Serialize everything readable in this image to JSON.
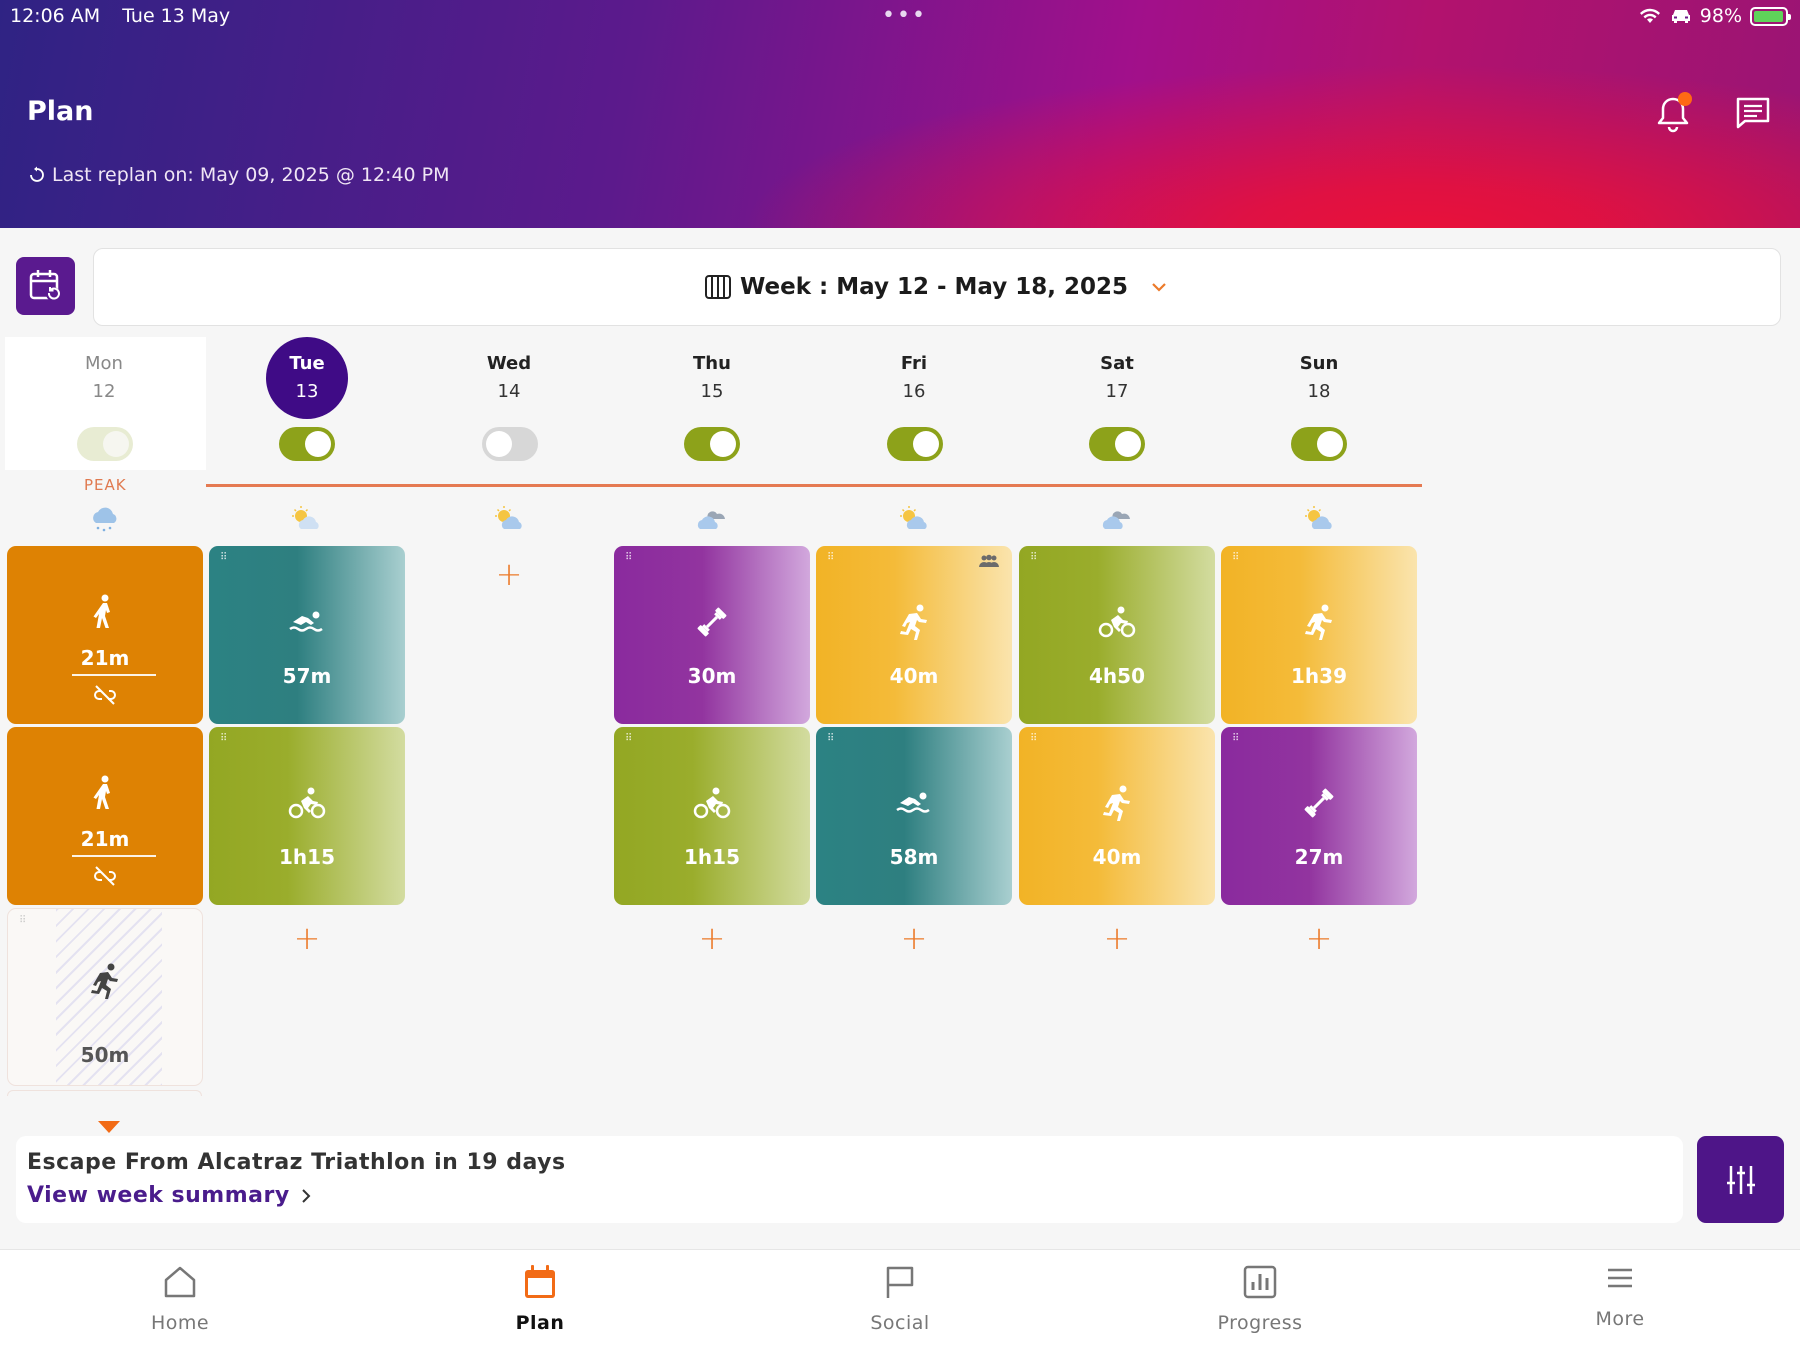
{
  "status_bar": {
    "time": "12:06 AM",
    "date": "Tue 13 May",
    "battery": "98%",
    "battery_level": 0.98
  },
  "header": {
    "title": "Plan",
    "replan": "Last replan on: May 09, 2025 @ 12:40 PM"
  },
  "week_selector": {
    "label": "Week : May 12 - May 18, 2025"
  },
  "days": [
    {
      "name": "Mon",
      "num": "12"
    },
    {
      "name": "Tue",
      "num": "13"
    },
    {
      "name": "Wed",
      "num": "14"
    },
    {
      "name": "Thu",
      "num": "15"
    },
    {
      "name": "Fri",
      "num": "16"
    },
    {
      "name": "Sat",
      "num": "17"
    },
    {
      "name": "Sun",
      "num": "18"
    }
  ],
  "peak_label": "PEAK",
  "workouts": {
    "mon_1": "21m",
    "mon_2": "21m",
    "mon_3": "50m",
    "tue_1": "57m",
    "tue_2": "1h15",
    "thu_1": "30m",
    "thu_2": "1h15",
    "fri_1": "40m",
    "fri_2": "58m",
    "sat_1": "4h50",
    "sat_2": "40m",
    "sun_1": "1h39",
    "sun_2": "27m"
  },
  "summary": {
    "race": "Escape From Alcatraz Triathlon in 19 days",
    "link": "View week summary"
  },
  "tabs": {
    "home": "Home",
    "plan": "Plan",
    "social": "Social",
    "progress": "Progress",
    "more": "More"
  },
  "colors": {
    "swim": "#2c8283",
    "bike": "#93a723",
    "strength": "#8a2a9e",
    "run": "#f2b326",
    "walk": "#de8203",
    "accent": "#ec7a2a",
    "brand": "#4e1588"
  }
}
